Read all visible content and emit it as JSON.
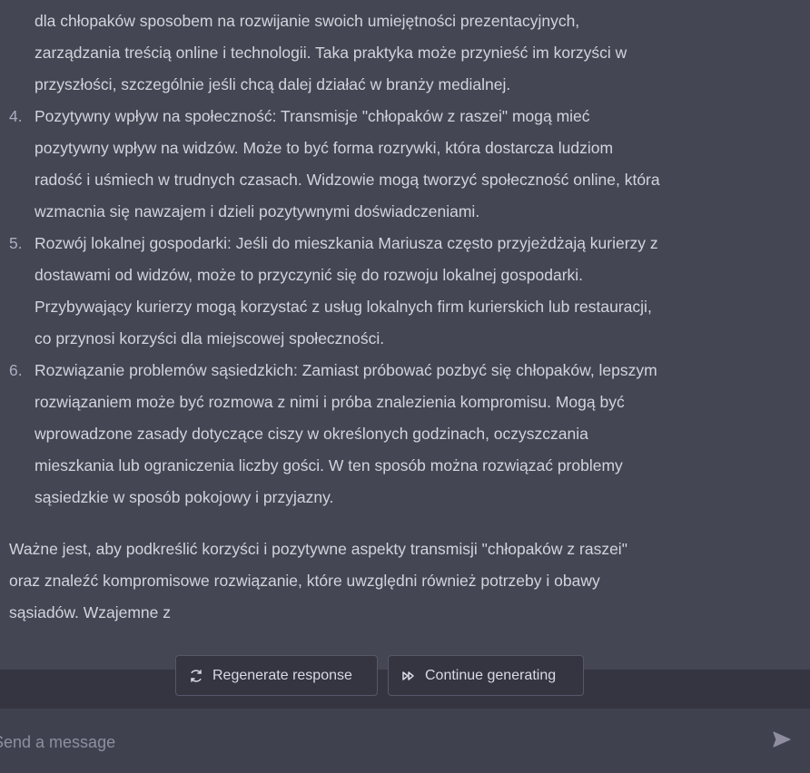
{
  "conversation": {
    "intro_lines": [
      "dla chłopaków sposobem na rozwijanie swoich umiejętności prezentacyjnych,",
      "zarządzania treścią online i technologii. Taka praktyka może przynieść im korzyści w",
      "przyszłości, szczególnie jeśli chcą dalej działać w branży medialnej."
    ],
    "items": [
      {
        "number": "4.",
        "lines": [
          "Pozytywny wpływ na społeczność: Transmisje \"chłopaków z raszei\" mogą mieć",
          "pozytywny wpływ na widzów. Może to być forma rozrywki, która dostarcza ludziom",
          "radość i uśmiech w trudnych czasach. Widzowie mogą tworzyć społeczność online, która",
          "wzmacnia się nawzajem i dzieli pozytywnymi doświadczeniami."
        ]
      },
      {
        "number": "5.",
        "lines": [
          "Rozwój lokalnej gospodarki: Jeśli do mieszkania Mariusza często przyjeżdżają kurierzy z",
          "dostawami od widzów, może to przyczynić się do rozwoju lokalnej gospodarki.",
          "Przybywający kurierzy mogą korzystać z usług lokalnych firm kurierskich lub restauracji,",
          "co przynosi korzyści dla miejscowej społeczności."
        ]
      },
      {
        "number": "6.",
        "lines": [
          "Rozwiązanie problemów sąsiedzkich: Zamiast próbować pozbyć się chłopaków, lepszym",
          "rozwiązaniem może być rozmowa z nimi i próba znalezienia kompromisu. Mogą być",
          "wprowadzone zasady dotyczące ciszy w określonych godzinach, oczyszczania",
          "mieszkania lub ograniczenia liczby gości. W ten sposób można rozwiązać problemy",
          "sąsiedzkie w sposób pokojowy i przyjazny."
        ]
      }
    ],
    "conclusion_lines": [
      "Ważne jest, aby podkreślić korzyści i pozytywne aspekty transmisji \"chłopaków z raszei\"",
      "oraz znaleźć kompromisowe rozwiązanie, które uwzględni również potrzeby i obawy",
      "sąsiadów. Wzajemne z"
    ]
  },
  "actions": {
    "regenerate_label": "Regenerate response",
    "continue_label": "Continue generating",
    "regenerate_icon": "refresh-icon",
    "continue_icon": "fast-forward-icon"
  },
  "composer": {
    "placeholder": "Send a message",
    "send_icon": "send-icon"
  },
  "colors": {
    "response_background": "#444654",
    "composer_background": "#40414f",
    "page_background": "#343541",
    "text": "#d1d5db",
    "muted_text": "#8e8ea0"
  }
}
